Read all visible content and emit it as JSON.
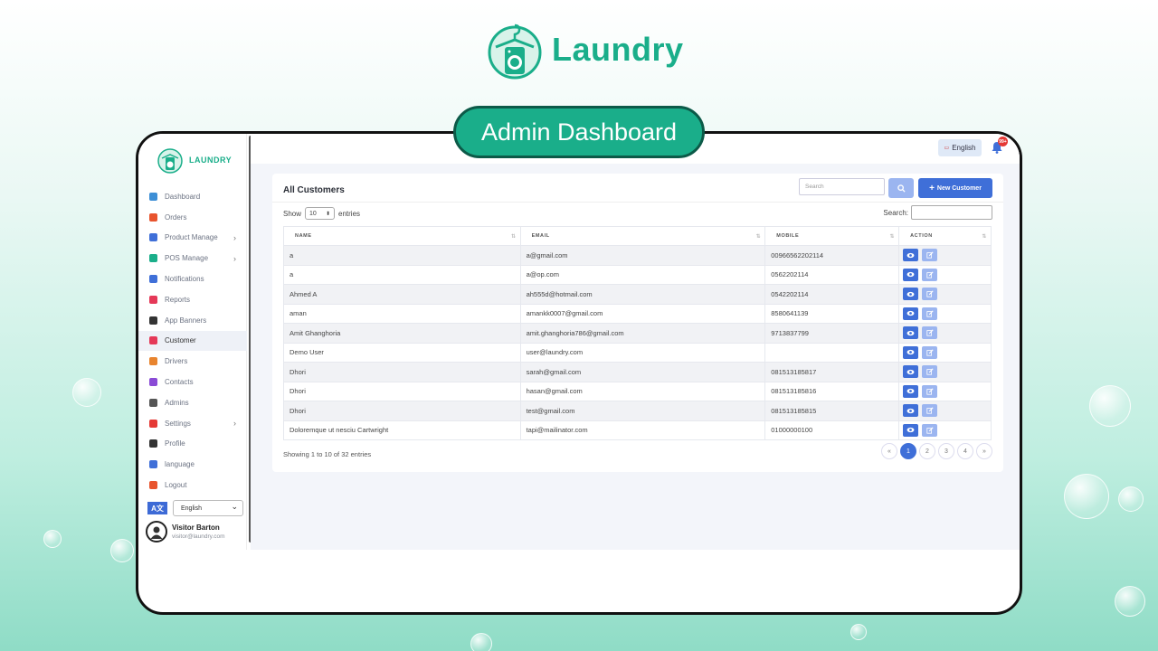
{
  "brand": {
    "name": "Laundry"
  },
  "banner": {
    "label": "Admin Dashboard"
  },
  "sidebar": {
    "logo_text": "LAUNDRY",
    "items": [
      {
        "label": "Dashboard",
        "icon": "monitor-icon",
        "color": "#3d8fd6",
        "chevron": false
      },
      {
        "label": "Orders",
        "icon": "cart-icon",
        "color": "#e8542e",
        "chevron": false
      },
      {
        "label": "Product Manage",
        "icon": "grid-icon",
        "color": "#3f6fd8",
        "chevron": true
      },
      {
        "label": "POS Manage",
        "icon": "store-icon",
        "color": "#1aae8a",
        "chevron": true
      },
      {
        "label": "Notifications",
        "icon": "bell-icon",
        "color": "#3f6fd8",
        "chevron": false
      },
      {
        "label": "Reports",
        "icon": "file-icon",
        "color": "#e53958",
        "chevron": false
      },
      {
        "label": "App Banners",
        "icon": "image-icon",
        "color": "#333333",
        "chevron": false
      },
      {
        "label": "Customer",
        "icon": "users-icon",
        "color": "#e53958",
        "chevron": false,
        "active": true
      },
      {
        "label": "Drivers",
        "icon": "truck-icon",
        "color": "#e8842e",
        "chevron": false
      },
      {
        "label": "Contacts",
        "icon": "chat-icon",
        "color": "#8a4bd6",
        "chevron": false
      },
      {
        "label": "Admins",
        "icon": "admin-icon",
        "color": "#555555",
        "chevron": false
      },
      {
        "label": "Settings",
        "icon": "gear-icon",
        "color": "#e53935",
        "chevron": true
      },
      {
        "label": "Profile",
        "icon": "user-icon",
        "color": "#333333",
        "chevron": false
      },
      {
        "label": "language",
        "icon": "language-icon",
        "color": "#3f6fd8",
        "chevron": false
      },
      {
        "label": "Logout",
        "icon": "logout-icon",
        "color": "#e8542e",
        "chevron": false
      }
    ],
    "language_value": "English",
    "user": {
      "name": "Visitor Barton",
      "email": "visitor@laundry.com"
    }
  },
  "topbar": {
    "language": "English",
    "notification_count": "99+"
  },
  "card": {
    "title": "All Customers",
    "search_placeholder": "Search",
    "new_button": "New Customer",
    "show_label": "Show",
    "entries_value": "10",
    "entries_label": "entries",
    "search_label": "Search:"
  },
  "table": {
    "headers": [
      "Name",
      "Email",
      "Mobile",
      "Action"
    ],
    "rows": [
      [
        "a",
        "a@gmail.com",
        "00966562202114"
      ],
      [
        "a",
        "a@op.com",
        "0562202114"
      ],
      [
        "Ahmed A",
        "ah555d@hotmail.com",
        "0542202114"
      ],
      [
        "aman",
        "amankk0007@gmail.com",
        "8580641139"
      ],
      [
        "Amit Ghanghoria",
        "amit.ghanghoria786@gmail.com",
        "9713837799"
      ],
      [
        "Demo User",
        "user@laundry.com",
        ""
      ],
      [
        "Dhori",
        "sarah@gmail.com",
        "081513185817"
      ],
      [
        "Dhori",
        "hasan@gmail.com",
        "081513185816"
      ],
      [
        "Dhori",
        "test@gmail.com",
        "081513185815"
      ],
      [
        "Doloremque ut nesciu Cartwright",
        "tapi@mailinator.com",
        "01000000100"
      ]
    ]
  },
  "footer": {
    "showing": "Showing 1 to 10 of 32 entries",
    "pages": [
      "«",
      "1",
      "2",
      "3",
      "4",
      "»"
    ],
    "active_page": "1"
  }
}
